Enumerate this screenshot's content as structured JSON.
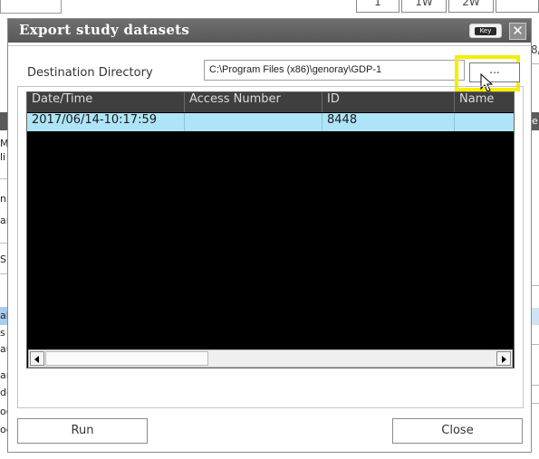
{
  "background": {
    "period_buttons": [
      "1",
      "1W",
      "2W"
    ],
    "right_fragment_top": "8/",
    "right_fragment_header": "e",
    "left_fragments": [
      "M",
      "li",
      "n",
      "ar",
      "S",
      "",
      "ak",
      "s",
      "au",
      "ar",
      "dc",
      "od",
      "od"
    ]
  },
  "dialog": {
    "title": "Export study datasets",
    "key_button_label": "Key",
    "close_icon_glyph": "✕",
    "destination": {
      "label": "Destination Directory",
      "path": "C:\\Program Files (x86)\\genoray\\GDP-1",
      "browse_label": "..."
    },
    "table": {
      "columns": [
        "Date/Time",
        "Access Number",
        "ID",
        "Name"
      ],
      "rows": [
        {
          "datetime": "2017/06/14-10:17:59",
          "access_number": "",
          "id": "8448",
          "name": ""
        }
      ]
    },
    "run_label": "Run",
    "close_label": "Close",
    "highlight_color": "#f4ef00"
  }
}
